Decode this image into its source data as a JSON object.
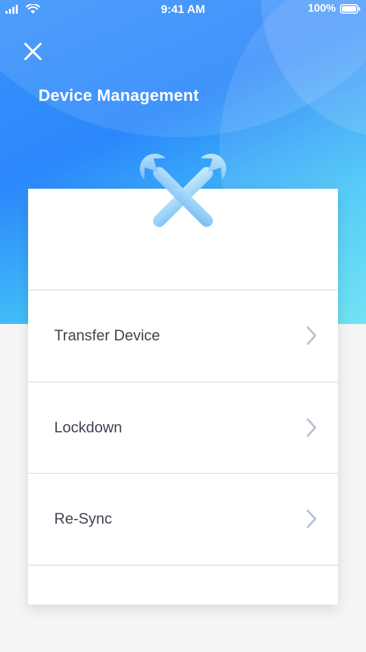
{
  "status_bar": {
    "time": "9:41 AM",
    "battery": "100%",
    "signal_icon": "signal-icon",
    "wifi_icon": "wifi-icon",
    "battery_icon": "battery-icon"
  },
  "header": {
    "title": "Device Management",
    "close_icon": "close-icon",
    "illustration": "tools-icon"
  },
  "menu": {
    "items": [
      {
        "label": "Transfer Device",
        "icon": "chevron-right-icon"
      },
      {
        "label": "Lockdown",
        "icon": "chevron-right-icon"
      },
      {
        "label": "Re-Sync",
        "icon": "chevron-right-icon"
      }
    ]
  },
  "colors": {
    "hero_start": "#3b93fb",
    "hero_end": "#62e0f2",
    "text": "#3e4550",
    "chevron": "#b5c3d3",
    "background": "#f5f5f5"
  }
}
